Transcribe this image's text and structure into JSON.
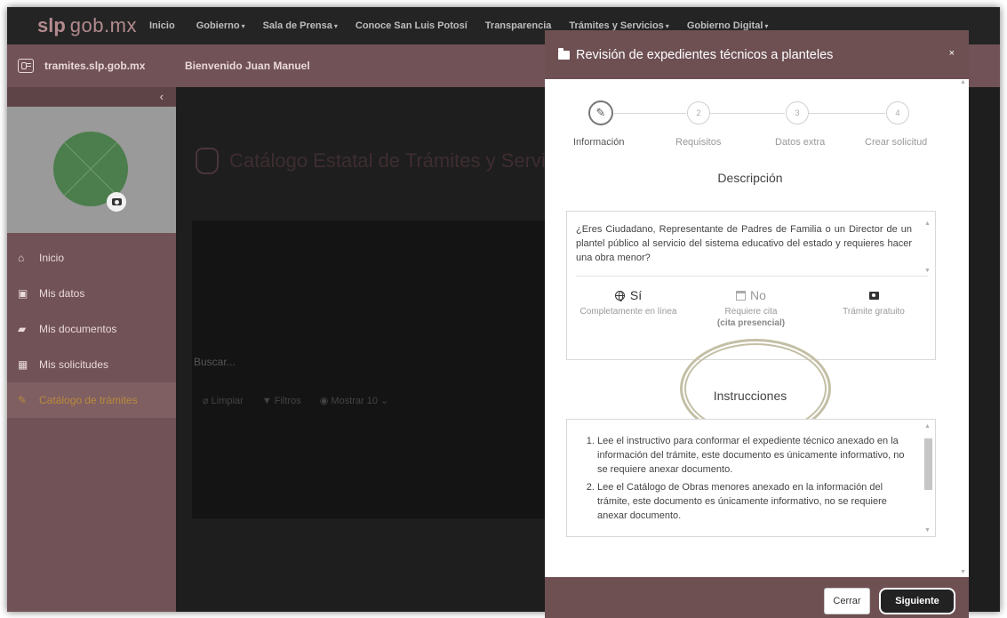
{
  "topnav": {
    "logo_slp": "slp",
    "logo_gob": "gob.mx",
    "items": [
      "Inicio",
      "Gobierno",
      "Sala de Prensa",
      "Conoce San Luis Potosí",
      "Transparencia",
      "Trámites y Servicios",
      "Gobierno Digital"
    ],
    "caret": "▾"
  },
  "subbar": {
    "site": "tramites.slp.gob.mx",
    "welcome": "Bienvenido Juan Manuel"
  },
  "sidebar": {
    "collapse": "‹",
    "items": [
      {
        "label": "Inicio",
        "icon": "⌂"
      },
      {
        "label": "Mis datos",
        "icon": "▣"
      },
      {
        "label": "Mis documentos",
        "icon": "▰"
      },
      {
        "label": "Mis solicitudes",
        "icon": "▦"
      },
      {
        "label": "Catálogo de trámites",
        "icon": "✎"
      }
    ]
  },
  "content": {
    "title": "Catálogo Estatal de Trámites y Servicios",
    "search": "Buscar...",
    "tools": {
      "clear": "⌀ Limpiar",
      "filters": "▼ Filtros",
      "show": "◉ Mostrar 10 ⌄"
    }
  },
  "modal": {
    "title": "Revisión de expedientes técnicos a planteles",
    "close": "×",
    "steps": [
      {
        "num": "✎",
        "label": "Información"
      },
      {
        "num": "2",
        "label": "Requisitos"
      },
      {
        "num": "3",
        "label": "Datos extra"
      },
      {
        "num": "4",
        "label": "Crear solicitud"
      }
    ],
    "description": {
      "heading": "Descripción",
      "text": "¿Eres Ciudadano, Representante de Padres de Familia o un Director de un plantel público al servicio del sistema educativo del estado y requieres hacer una obra menor?",
      "features": [
        {
          "value": "Sí",
          "caption": "Completamente en línea",
          "extra": ""
        },
        {
          "value": "No",
          "caption": "Requiere cita",
          "extra": "(cita presencial)"
        },
        {
          "value": "",
          "caption": "Trámite gratuito",
          "extra": ""
        }
      ]
    },
    "instructions": {
      "heading": "Instrucciones",
      "items": [
        "Lee el instructivo para conformar el expediente técnico anexado en la información del trámite, este documento es únicamente informativo, no se requiere anexar documento.",
        "Lee el Catálogo de Obras menores anexado en la información del trámite, este documento es únicamente informativo, no se requiere anexar documento."
      ]
    },
    "buttons": {
      "close": "Cerrar",
      "next": "Siguiente"
    }
  },
  "colors": {
    "brand": "#6e5053",
    "sidebar": "#715256",
    "accent": "#b88a3c",
    "highlight_ring": "#c3bfa5"
  },
  "icons": {
    "step1": "pencil-icon",
    "online": "globe-icon",
    "appointment": "calendar-icon",
    "free": "money-icon",
    "header": "folder-icon",
    "camera": "camera-icon"
  }
}
